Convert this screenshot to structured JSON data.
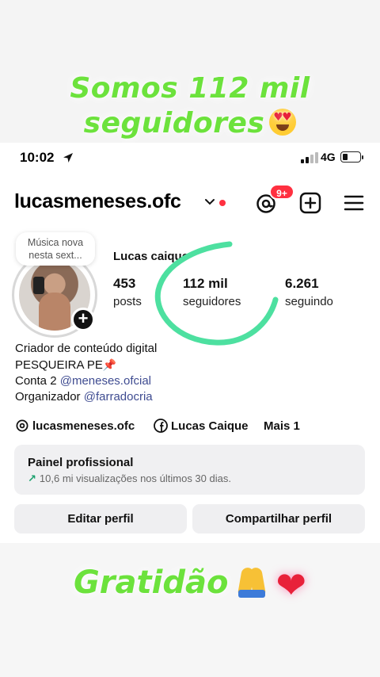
{
  "story": {
    "headline_top_line1": "Somos 112 mil",
    "headline_top_line2": "seguidores",
    "headline_top_emoji": "heart-eyes-emoji",
    "headline_bottom": "Gratidão",
    "headline_bottom_emojis": [
      "folded-hands-emoji",
      "red-heart-emoji"
    ],
    "accent_color": "#6ce23c"
  },
  "status_bar": {
    "time": "10:02",
    "network": "4G",
    "icons": [
      "location-arrow-icon",
      "signal-icon",
      "battery-icon"
    ]
  },
  "header": {
    "username": "lucasmeneses.ofc",
    "notification_badge": "9+",
    "icons": [
      "chevron-down-icon",
      "threads-icon",
      "create-icon",
      "menu-icon"
    ]
  },
  "profile": {
    "note": "Música nova nesta sext...",
    "display_name": "Lucas caique",
    "stats": {
      "posts_value": "453",
      "posts_label": "posts",
      "followers_value": "112 mil",
      "followers_label": "seguidores",
      "following_value": "6.261",
      "following_label": "seguindo"
    },
    "bio": {
      "line1": "Criador de conteúdo digital",
      "line2": "PESQUEIRA PE",
      "line3_prefix": "Conta 2 ",
      "line3_link": "@meneses.ofcial",
      "line4_prefix": "Organizador ",
      "line4_link": "@farradocria"
    },
    "links": {
      "threads": "lucasmeneses.ofc",
      "facebook": "Lucas Caique",
      "more": "Mais 1"
    }
  },
  "pro_panel": {
    "title": "Painel profissional",
    "subtitle": "10,6 mi visualizações nos últimos 30 dias."
  },
  "actions": {
    "edit": "Editar perfil",
    "share": "Compartilhar perfil"
  }
}
